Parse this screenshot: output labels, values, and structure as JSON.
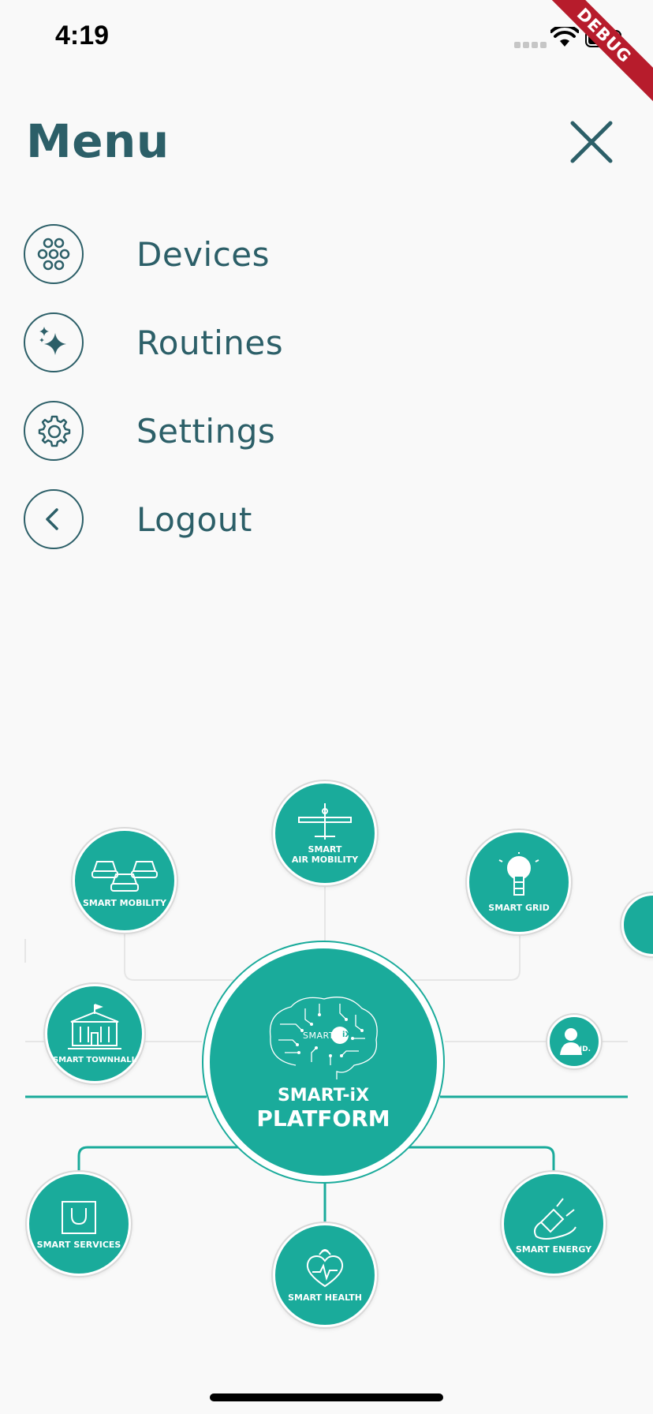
{
  "status_bar": {
    "time": "4:19"
  },
  "debug_banner": "DEBUG",
  "menu": {
    "title": "Menu",
    "items": [
      {
        "label": "Devices",
        "icon": "devices-icon"
      },
      {
        "label": "Routines",
        "icon": "sparkle-icon"
      },
      {
        "label": "Settings",
        "icon": "gear-icon"
      },
      {
        "label": "Logout",
        "icon": "chevron-left-icon"
      }
    ]
  },
  "platform": {
    "center_top": "SMART",
    "center_badge": "iX",
    "center_title": "SMART-iX",
    "center_subtitle": "PLATFORM",
    "nodes": {
      "air_mobility": "SMART\nAIR MOBILITY",
      "mobility": "SMART MOBILITY",
      "grid": "SMART GRID",
      "townhall": "SMART TOWNHALL",
      "services": "SMART SERVICES",
      "health": "SMART HEALTH",
      "energy": "SMART ENERGY",
      "id_badge": "ID."
    }
  },
  "colors": {
    "primary": "#2c5f68",
    "teal": "#1aab9b",
    "background": "#f9f9f9",
    "debug": "#b71c2c"
  }
}
